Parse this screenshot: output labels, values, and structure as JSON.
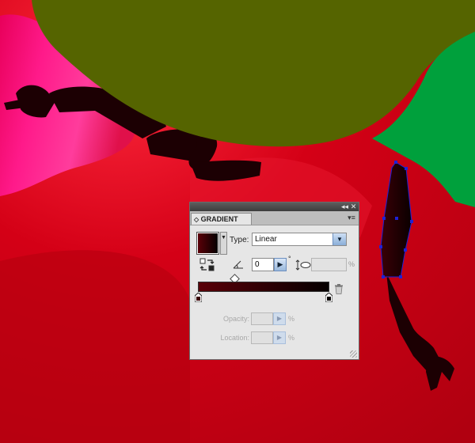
{
  "panel": {
    "title": "GRADIENT",
    "tab_arrows": "◇",
    "titlebar": {
      "collapse_icon": "double-left-arrow-icon",
      "close_icon": "close-icon",
      "collapse_glyph": "◂◂",
      "close_glyph": "✕"
    },
    "menu_glyph": "▾≡",
    "type_label": "Type:",
    "type_value": "Linear",
    "angle_value": "0",
    "degree_symbol": "°",
    "aspect_percent": "%",
    "opacity_label": "Opacity:",
    "opacity_percent": "%",
    "location_label": "Location:",
    "location_percent": "%",
    "gradient": {
      "start_color": "#5a0008",
      "end_color": "#050000"
    }
  },
  "artwork": {
    "background_color": "#c00012",
    "magenta_color": "#ff0f80",
    "olive_color": "#556400",
    "green_color": "#00a03c",
    "limb_color": "#1c0003",
    "selection_color": "#1e22d8"
  }
}
